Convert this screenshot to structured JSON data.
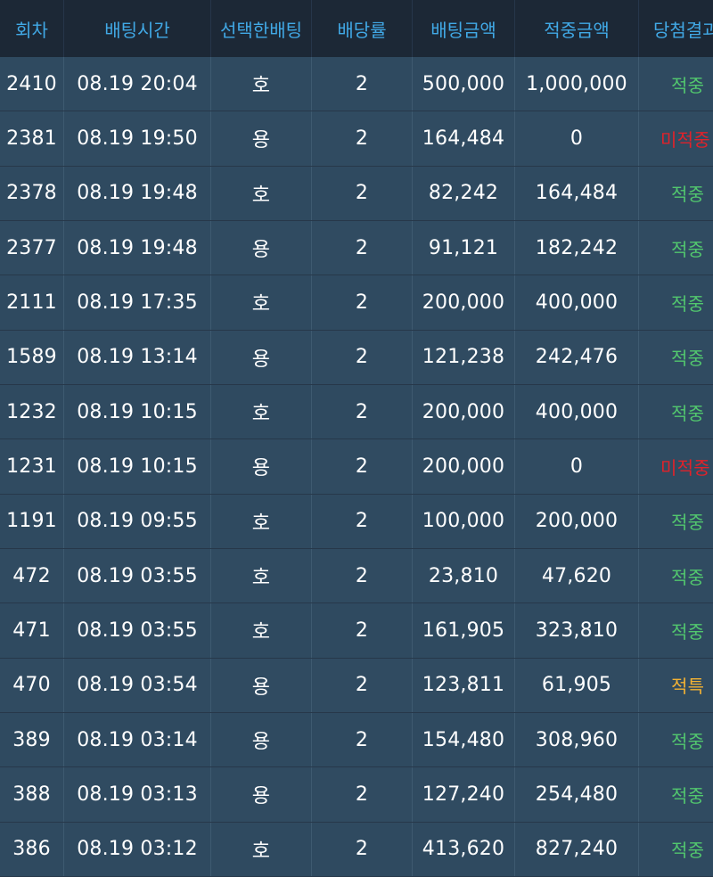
{
  "columns": [
    "회차",
    "배팅시간",
    "선택한배팅",
    "배당률",
    "배팅금액",
    "적중금액",
    "당첨결과"
  ],
  "rows": [
    {
      "round": "2410",
      "time": "08.19 20:04",
      "pick": "호",
      "odds": "2",
      "bet": "500,000",
      "win": "1,000,000",
      "result": "적중",
      "status": "win"
    },
    {
      "round": "2381",
      "time": "08.19 19:50",
      "pick": "용",
      "odds": "2",
      "bet": "164,484",
      "win": "0",
      "result": "미적중",
      "status": "lose"
    },
    {
      "round": "2378",
      "time": "08.19 19:48",
      "pick": "호",
      "odds": "2",
      "bet": "82,242",
      "win": "164,484",
      "result": "적중",
      "status": "win"
    },
    {
      "round": "2377",
      "time": "08.19 19:48",
      "pick": "용",
      "odds": "2",
      "bet": "91,121",
      "win": "182,242",
      "result": "적중",
      "status": "win"
    },
    {
      "round": "2111",
      "time": "08.19 17:35",
      "pick": "호",
      "odds": "2",
      "bet": "200,000",
      "win": "400,000",
      "result": "적중",
      "status": "win"
    },
    {
      "round": "1589",
      "time": "08.19 13:14",
      "pick": "용",
      "odds": "2",
      "bet": "121,238",
      "win": "242,476",
      "result": "적중",
      "status": "win"
    },
    {
      "round": "1232",
      "time": "08.19 10:15",
      "pick": "호",
      "odds": "2",
      "bet": "200,000",
      "win": "400,000",
      "result": "적중",
      "status": "win"
    },
    {
      "round": "1231",
      "time": "08.19 10:15",
      "pick": "용",
      "odds": "2",
      "bet": "200,000",
      "win": "0",
      "result": "미적중",
      "status": "lose"
    },
    {
      "round": "1191",
      "time": "08.19 09:55",
      "pick": "호",
      "odds": "2",
      "bet": "100,000",
      "win": "200,000",
      "result": "적중",
      "status": "win"
    },
    {
      "round": "472",
      "time": "08.19 03:55",
      "pick": "호",
      "odds": "2",
      "bet": "23,810",
      "win": "47,620",
      "result": "적중",
      "status": "win"
    },
    {
      "round": "471",
      "time": "08.19 03:55",
      "pick": "호",
      "odds": "2",
      "bet": "161,905",
      "win": "323,810",
      "result": "적중",
      "status": "win"
    },
    {
      "round": "470",
      "time": "08.19 03:54",
      "pick": "용",
      "odds": "2",
      "bet": "123,811",
      "win": "61,905",
      "result": "적특",
      "status": "special"
    },
    {
      "round": "389",
      "time": "08.19 03:14",
      "pick": "용",
      "odds": "2",
      "bet": "154,480",
      "win": "308,960",
      "result": "적중",
      "status": "win"
    },
    {
      "round": "388",
      "time": "08.19 03:13",
      "pick": "용",
      "odds": "2",
      "bet": "127,240",
      "win": "254,480",
      "result": "적중",
      "status": "win"
    },
    {
      "round": "386",
      "time": "08.19 03:12",
      "pick": "호",
      "odds": "2",
      "bet": "413,620",
      "win": "827,240",
      "result": "적중",
      "status": "win"
    }
  ],
  "colors": {
    "header_bg": "#1c2836",
    "header_text": "#41a9e6",
    "row_bg": "#2f4a60",
    "win": "#52c76e",
    "lose": "#e0222a",
    "special": "#f3b233"
  }
}
